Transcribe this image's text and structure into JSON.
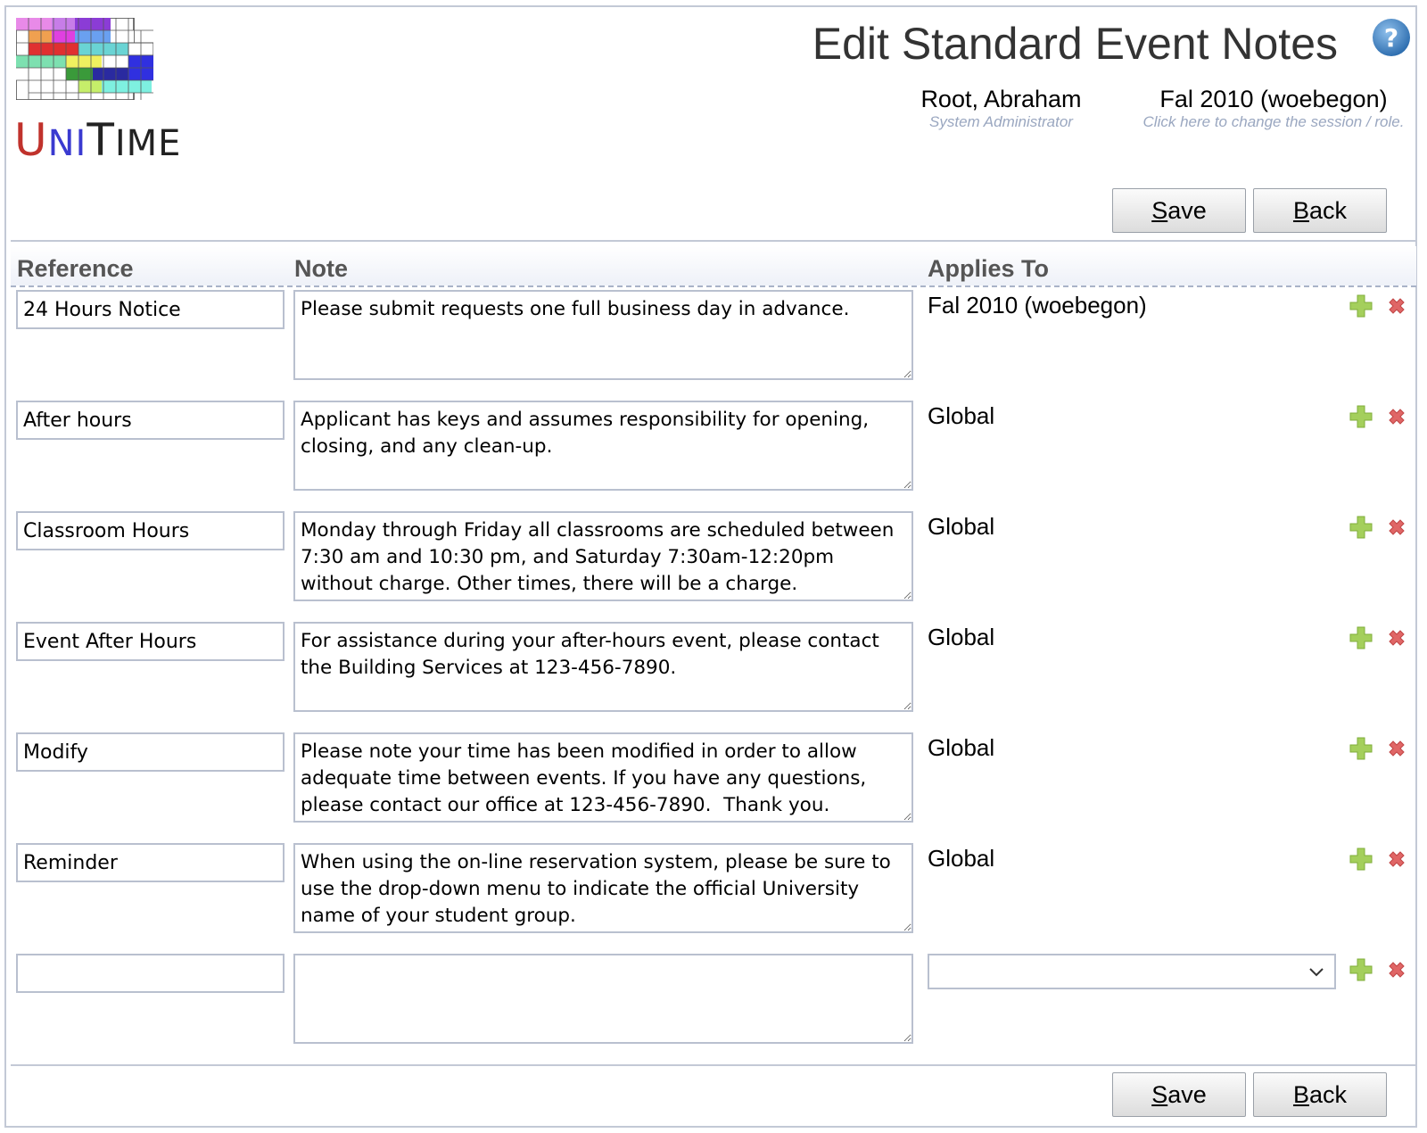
{
  "header": {
    "title": "Edit Standard Event Notes",
    "user": {
      "name": "Root, Abraham",
      "role": "System Administrator"
    },
    "session": {
      "name": "Fal 2010 (woebegon)",
      "hint": "Click here to change the session / role."
    }
  },
  "logo": {
    "text_u": "U",
    "text_ni": "NI",
    "text_t": "T",
    "text_ime": "IME"
  },
  "buttons": {
    "save_access": "S",
    "save_rest": "ave",
    "back_access": "B",
    "back_rest": "ack"
  },
  "table": {
    "columns": {
      "reference": "Reference",
      "note": "Note",
      "applies_to": "Applies To"
    },
    "rows": [
      {
        "reference": "24 Hours Notice",
        "note": "Please submit requests one full business day in advance.",
        "applies_to": "Fal 2010 (woebegon)"
      },
      {
        "reference": "After hours",
        "note": "Applicant has keys and assumes responsibility for opening, closing, and any clean-up.",
        "applies_to": "Global"
      },
      {
        "reference": "Classroom Hours",
        "note": "Monday through Friday all classrooms are scheduled between 7:30 am and 10:30 pm, and Saturday 7:30am-12:20pm without charge. Other times, there will be a charge.",
        "applies_to": "Global"
      },
      {
        "reference": "Event After Hours",
        "note": "For assistance during your after-hours event, please contact the Building Services at 123-456-7890.",
        "applies_to": "Global"
      },
      {
        "reference": "Modify",
        "note": "Please note your time has been modified in order to allow adequate time between events. If you have any questions, please contact our office at 123-456-7890.  Thank you.",
        "applies_to": "Global"
      },
      {
        "reference": "Reminder",
        "note": "When using the on-line reservation system, please be sure to use the drop-down menu to indicate the official University name of your student group.",
        "applies_to": "Global"
      },
      {
        "reference": "",
        "note": "",
        "applies_to": ""
      }
    ]
  },
  "colors": {
    "add_icon": "#a4cf5c",
    "delete_icon": "#e06666",
    "help_icon": "#4a86c5",
    "subtext": "#9aa7c0"
  },
  "icons": {
    "help": "question-icon",
    "add": "plus-icon",
    "delete": "x-icon",
    "dropdown": "chevron-down-icon"
  }
}
